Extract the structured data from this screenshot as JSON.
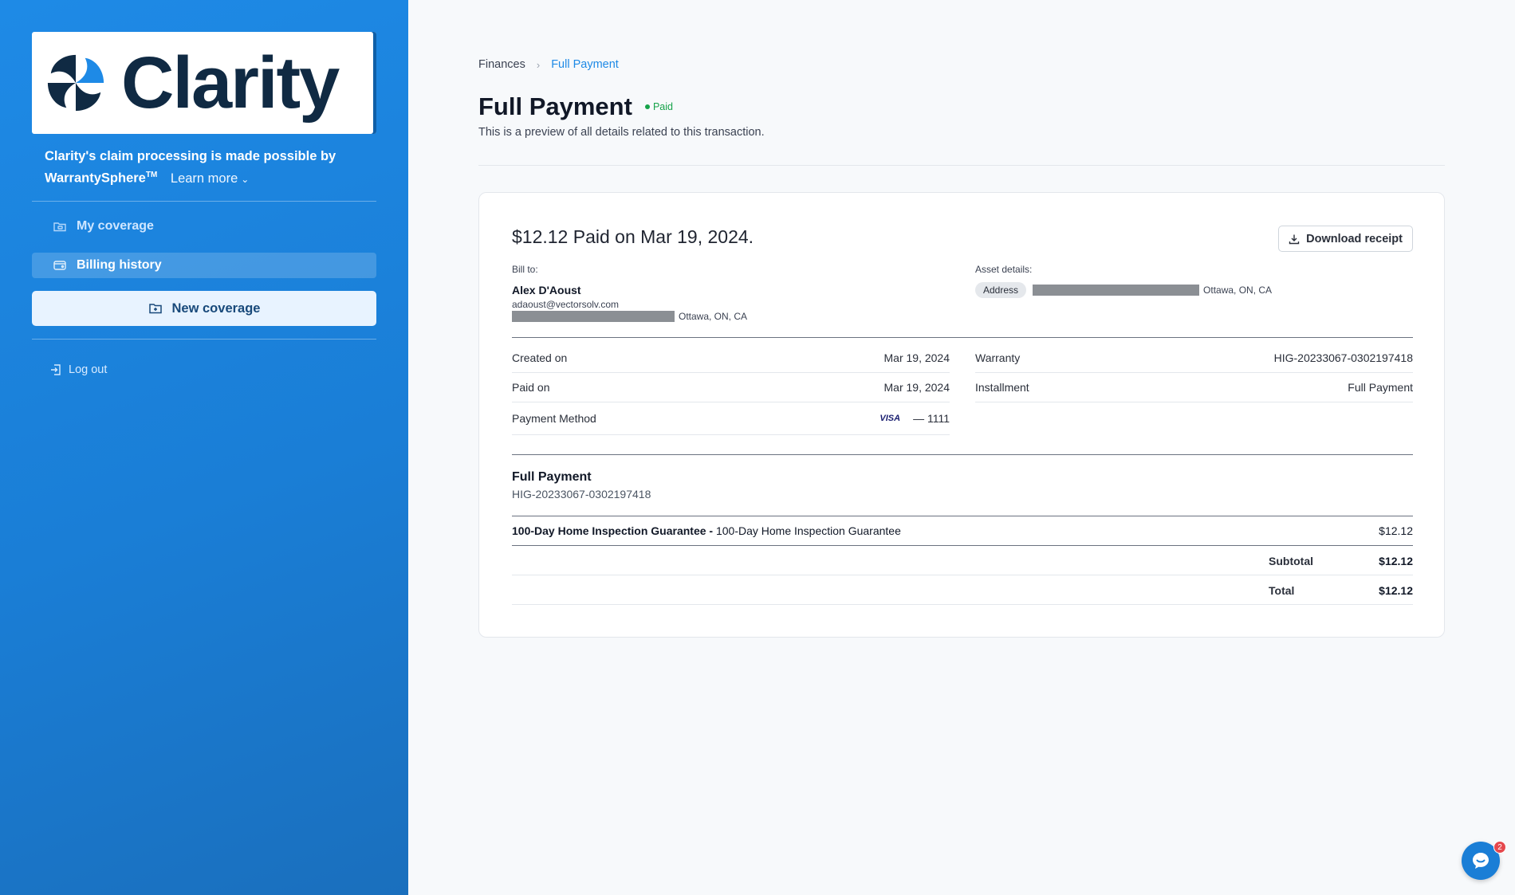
{
  "brand": {
    "logo_text": "Clarity",
    "accent": "#1e8ae6",
    "dark": "#102a43"
  },
  "sidebar": {
    "tagline_main": "Clarity's claim processing is made possible by WarrantySphere",
    "tagline_sup": "TM",
    "learn_more": "Learn more",
    "items": [
      {
        "label": "My coverage",
        "icon": "folder-icon",
        "active": false
      },
      {
        "label": "Billing history",
        "icon": "wallet-icon",
        "active": true
      }
    ],
    "new_coverage": "New coverage",
    "logout": "Log out"
  },
  "breadcrumb": {
    "parent": "Finances",
    "current": "Full Payment"
  },
  "page": {
    "title": "Full Payment",
    "status": "Paid",
    "status_color": "#16a34a",
    "subtitle": "This is a preview of all details related to this transaction."
  },
  "receipt": {
    "headline": "$12.12 Paid on Mar 19, 2024.",
    "download_label": "Download receipt",
    "bill_to_label": "Bill to:",
    "bill_name": "Alex D'Aoust",
    "bill_email": "adaoust@vectorsolv.com",
    "bill_city": "Ottawa, ON, CA",
    "asset_label": "Asset details:",
    "asset_chip": "Address",
    "asset_city": "Ottawa, ON, CA",
    "details_left": [
      {
        "label": "Created on",
        "value": "Mar 19, 2024"
      },
      {
        "label": "Paid on",
        "value": "Mar 19, 2024"
      }
    ],
    "payment_method_label": "Payment Method",
    "card_brand": "VISA",
    "card_last4": "— 1111",
    "details_right": [
      {
        "label": "Warranty",
        "value": "HIG-20233067-0302197418"
      },
      {
        "label": "Installment",
        "value": "Full Payment"
      }
    ],
    "item_title": "Full Payment",
    "item_ref": "HIG-20233067-0302197418",
    "line_bold": "100-Day Home Inspection Guarantee -",
    "line_desc": "100-Day Home Inspection Guarantee",
    "line_amount": "$12.12",
    "subtotal_label": "Subtotal",
    "subtotal": "$12.12",
    "total_label": "Total",
    "total": "$12.12"
  },
  "chat": {
    "badge": "2",
    "icon": "chat-icon"
  }
}
